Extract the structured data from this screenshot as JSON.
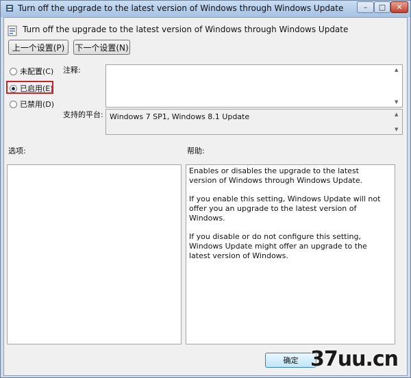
{
  "window": {
    "title": "Turn off the upgrade to the latest version of Windows through Windows Update",
    "controls": {
      "minimize": "–",
      "maximize": "□",
      "close": "✕"
    }
  },
  "header": {
    "icon": "policy-setting-icon",
    "title": "Turn off the upgrade to the latest version of Windows through Windows Update"
  },
  "nav": {
    "prev_label": "上一个设置(P)",
    "next_label": "下一个设置(N)"
  },
  "radio_options": [
    {
      "label": "未配置(C)",
      "selected": false
    },
    {
      "label": "已启用(E)",
      "selected": true
    },
    {
      "label": "已禁用(D)",
      "selected": false
    }
  ],
  "comment": {
    "label": "注释:",
    "value": ""
  },
  "platform": {
    "label": "支持的平台:",
    "value": "Windows 7 SP1, Windows 8.1 Update"
  },
  "options": {
    "label": "选项:"
  },
  "help": {
    "label": "帮助:",
    "paragraphs": [
      "Enables or disables the upgrade to the latest version of Windows through Windows Update.",
      "If you enable this setting, Windows Update will not offer you an upgrade to the latest version of Windows.",
      "If you disable or do not configure this setting, Windows Update might offer an upgrade to the latest version of Windows."
    ]
  },
  "footer": {
    "ok_label": "确定"
  },
  "watermark": {
    "text": "37uu.cn"
  },
  "colors": {
    "selection_highlight": "#c8242c",
    "title_bar": "#b8cfec"
  }
}
